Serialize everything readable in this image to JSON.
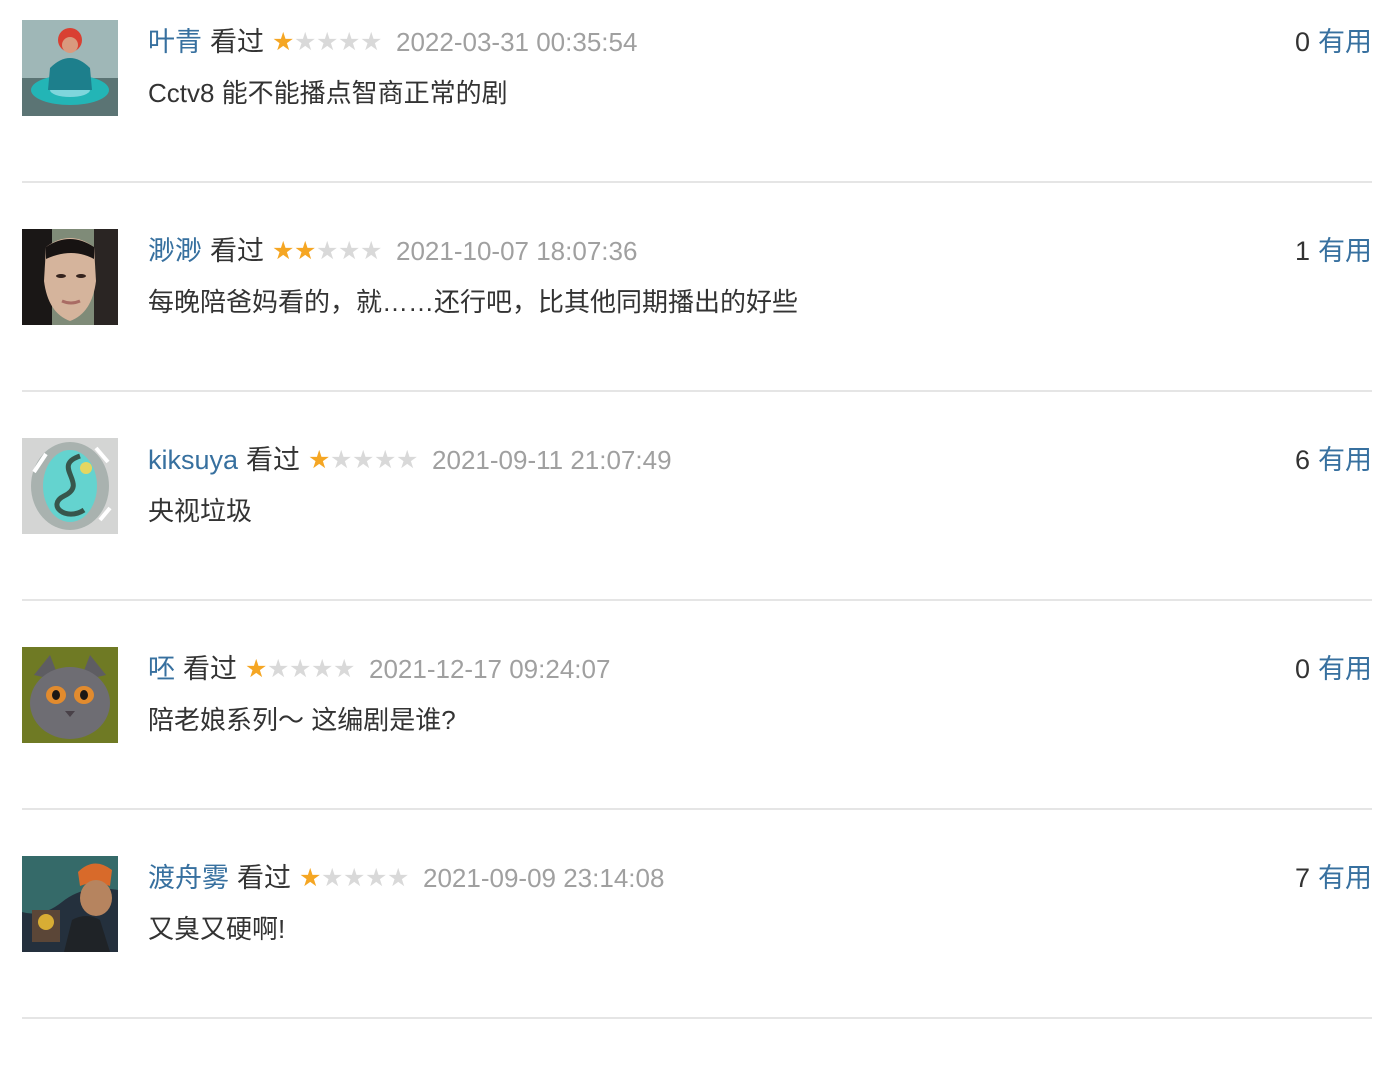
{
  "comments": [
    {
      "user": "叶青",
      "status": "看过",
      "rating": 1,
      "time": "2022-03-31 00:35:54",
      "useful_count": "0",
      "useful_label": "有用",
      "text": "Cctv8 能不能播点智商正常的剧"
    },
    {
      "user": "渺渺",
      "status": "看过",
      "rating": 2,
      "time": "2021-10-07 18:07:36",
      "useful_count": "1",
      "useful_label": "有用",
      "text": "每晚陪爸妈看的，就……还行吧，比其他同期播出的好些"
    },
    {
      "user": "kiksuya",
      "status": "看过",
      "rating": 1,
      "time": "2021-09-11 21:07:49",
      "useful_count": "6",
      "useful_label": "有用",
      "text": "央视垃圾"
    },
    {
      "user": "呸",
      "status": "看过",
      "rating": 1,
      "time": "2021-12-17 09:24:07",
      "useful_count": "0",
      "useful_label": "有用",
      "text": "陪老娘系列～ 这编剧是谁?"
    },
    {
      "user": "渡舟雾",
      "status": "看过",
      "rating": 1,
      "time": "2021-09-09 23:14:08",
      "useful_count": "7",
      "useful_label": "有用",
      "text": "又臭又硬啊!"
    }
  ],
  "colors": {
    "link": "#37709f",
    "star_on": "#f5a623",
    "star_off": "#d9d9d9",
    "time": "#a0a0a0",
    "divider": "#e5e5e5"
  }
}
